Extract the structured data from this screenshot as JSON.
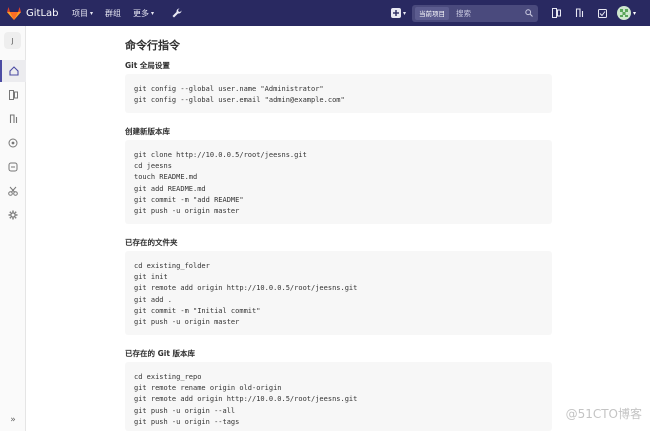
{
  "navbar": {
    "brand": "GitLab",
    "menu": [
      {
        "label": "项目",
        "caret": true
      },
      {
        "label": "群组",
        "caret": false
      },
      {
        "label": "更多",
        "caret": true
      }
    ],
    "search": {
      "scope": "当前项目",
      "placeholder": "搜索"
    },
    "color": "#292961"
  },
  "sidebar": {
    "project_initial": "J",
    "collapse": "»"
  },
  "page": {
    "title": "命令行指令",
    "sections": [
      {
        "heading": "Git 全局设置",
        "lines": [
          "git config --global user.name \"Administrator\"",
          "git config --global user.email \"admin@example.com\""
        ]
      },
      {
        "heading": "创建新版本库",
        "lines": [
          "git clone http://10.0.0.5/root/jeesns.git",
          "cd jeesns",
          "touch README.md",
          "git add README.md",
          "git commit -m \"add README\"",
          "git push -u origin master"
        ]
      },
      {
        "heading": "已存在的文件夹",
        "lines": [
          "cd existing_folder",
          "git init",
          "git remote add origin http://10.0.0.5/root/jeesns.git",
          "git add .",
          "git commit -m \"Initial commit\"",
          "git push -u origin master"
        ]
      },
      {
        "heading": "已存在的 Git 版本库",
        "lines": [
          "cd existing_repo",
          "git remote rename origin old-origin",
          "git remote add origin http://10.0.0.5/root/jeesns.git",
          "git push -u origin --all",
          "git push -u origin --tags"
        ]
      }
    ]
  },
  "watermark": "@51CTO博客"
}
